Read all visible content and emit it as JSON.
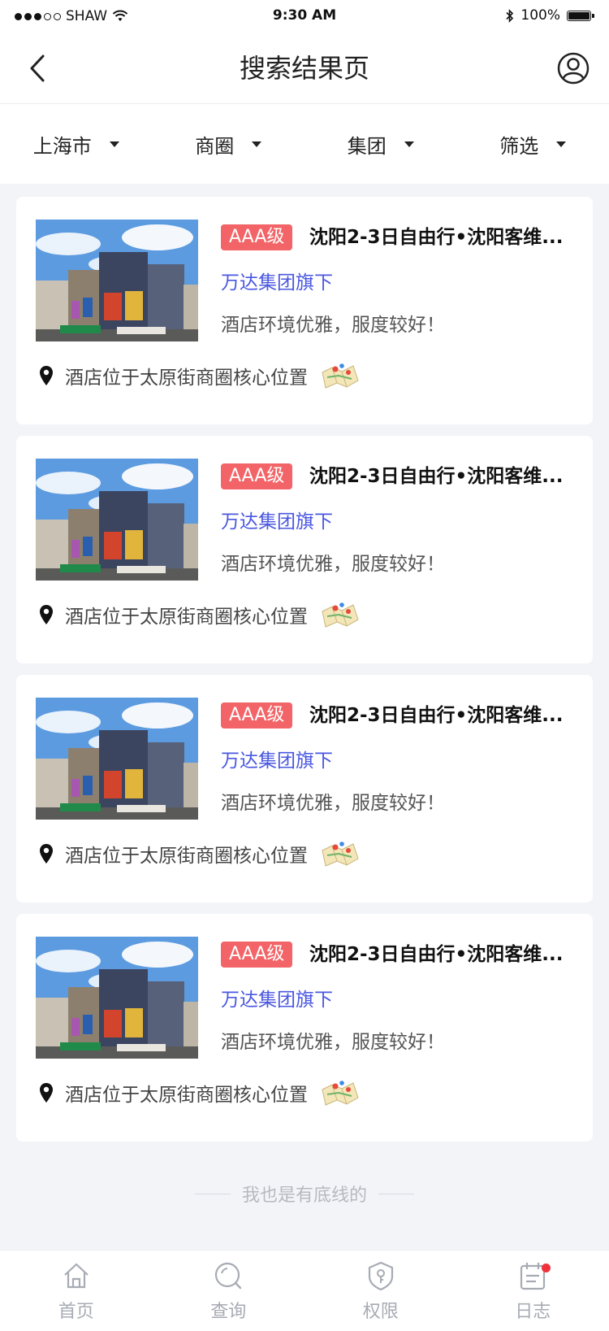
{
  "status_bar": {
    "carrier": "SHAW",
    "time": "9:30 AM",
    "battery": "100%"
  },
  "header": {
    "title": "搜索结果页"
  },
  "filters": [
    {
      "label": "上海市"
    },
    {
      "label": "商圈"
    },
    {
      "label": "集团"
    },
    {
      "label": "筛选"
    }
  ],
  "results": [
    {
      "badge": "AAA级",
      "title": "沈阳2-3日自由行•沈阳客维...",
      "group": "万达集团旗下",
      "desc": "酒店环境优雅，服度较好！",
      "address": "酒店位于太原街商圈核心位置"
    },
    {
      "badge": "AAA级",
      "title": "沈阳2-3日自由行•沈阳客维...",
      "group": "万达集团旗下",
      "desc": "酒店环境优雅，服度较好！",
      "address": "酒店位于太原街商圈核心位置"
    },
    {
      "badge": "AAA级",
      "title": "沈阳2-3日自由行•沈阳客维...",
      "group": "万达集团旗下",
      "desc": "酒店环境优雅，服度较好！",
      "address": "酒店位于太原街商圈核心位置"
    },
    {
      "badge": "AAA级",
      "title": "沈阳2-3日自由行•沈阳客维...",
      "group": "万达集团旗下",
      "desc": "酒店环境优雅，服度较好！",
      "address": "酒店位于太原街商圈核心位置"
    }
  ],
  "footer_text": "我也是有底线的",
  "tabbar": [
    {
      "label": "首页",
      "icon": "home-icon"
    },
    {
      "label": "查询",
      "icon": "search-icon"
    },
    {
      "label": "权限",
      "icon": "shield-key-icon"
    },
    {
      "label": "日志",
      "icon": "calendar-log-icon",
      "has_notification": true
    }
  ],
  "colors": {
    "badge": "#f26467",
    "group_link": "#4a57e0",
    "notification_dot": "#f0323c",
    "page_bg": "#f2f4f8"
  }
}
